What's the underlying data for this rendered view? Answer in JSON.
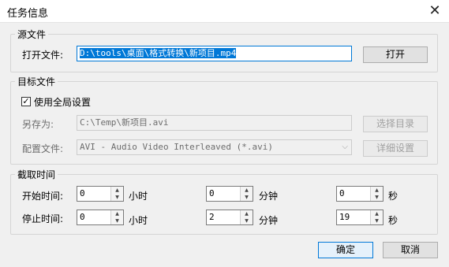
{
  "window": {
    "title": "任务信息",
    "close_glyph": "✕"
  },
  "source": {
    "group_title": "源文件",
    "open_label": "打开文件:",
    "open_value": "D:\\tools\\桌面\\格式转换\\新项目.mp4",
    "open_button": "打开"
  },
  "target": {
    "group_title": "目标文件",
    "use_global_label": "使用全局设置",
    "use_global_checked": true,
    "check_glyph": "✓",
    "saveas_label": "另存为:",
    "saveas_value": "C:\\Temp\\新项目.avi",
    "choose_dir_button": "选择目录",
    "config_label": "配置文件:",
    "config_value": "AVI - Audio Video Interleaved (*.avi)",
    "config_arrow": "⌵",
    "detail_button": "详细设置"
  },
  "clip": {
    "group_title": "截取时间",
    "start_label": "开始时间:",
    "stop_label": "停止时间:",
    "start": {
      "hours": "0",
      "minutes": "0",
      "seconds": "0"
    },
    "stop": {
      "hours": "0",
      "minutes": "2",
      "seconds": "19"
    },
    "unit_hours": "小时",
    "unit_minutes": "分钟",
    "unit_seconds": "秒",
    "spin_up_glyph": "▲",
    "spin_down_glyph": "▼"
  },
  "footer": {
    "ok_button": "确定",
    "cancel_button": "取消"
  }
}
